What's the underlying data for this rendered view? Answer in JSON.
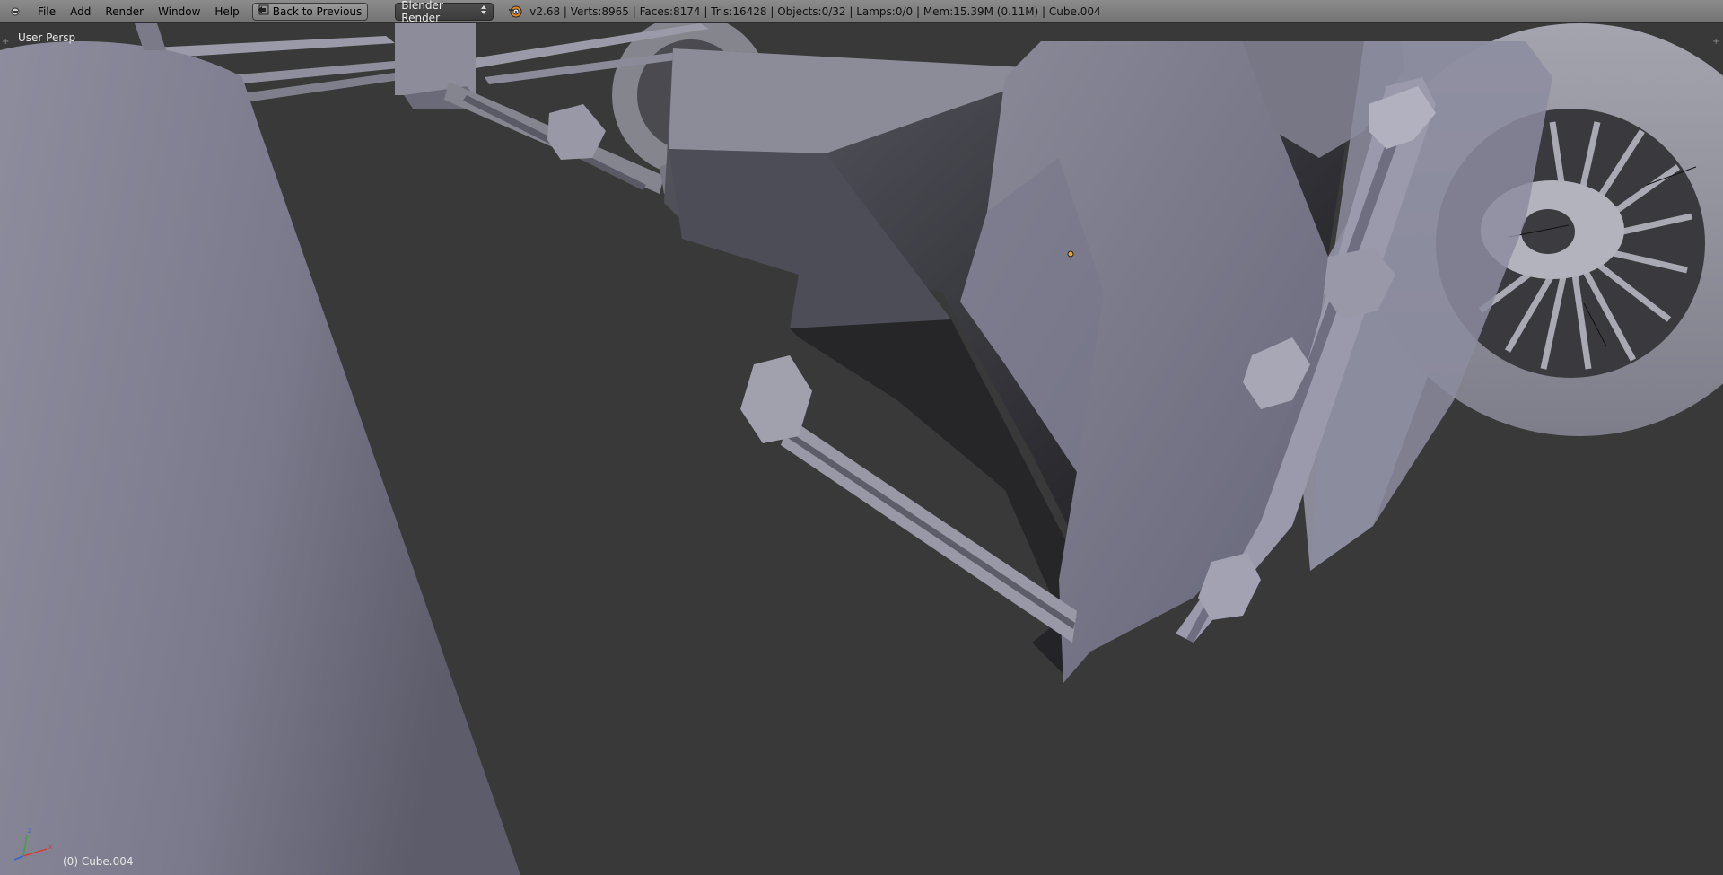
{
  "header": {
    "menus": [
      "File",
      "Add",
      "Render",
      "Window",
      "Help"
    ],
    "back_button_label": "Back to Previous",
    "render_engine": "Blender Render",
    "stats": "v2.68 | Verts:8965 | Faces:8174 | Tris:16428 | Objects:0/32 | Lamps:0/0 | Mem:15.39M (0.11M) | Cube.004"
  },
  "viewport": {
    "view_name": "User Persp",
    "active_object": "(0) Cube.004",
    "axes": [
      "x",
      "y",
      "z"
    ]
  },
  "colors": {
    "header_bg": "#7f7f7f",
    "viewport_bg": "#393939",
    "mesh_light": "#9a9aaa",
    "mesh_dark": "#202024",
    "origin_dot": "#f0a030"
  },
  "icons": {
    "area_menu": "area-menu-icon",
    "back": "back-icon",
    "render": "render-engine-icon",
    "dropdown": "dropdown-arrows-icon"
  }
}
